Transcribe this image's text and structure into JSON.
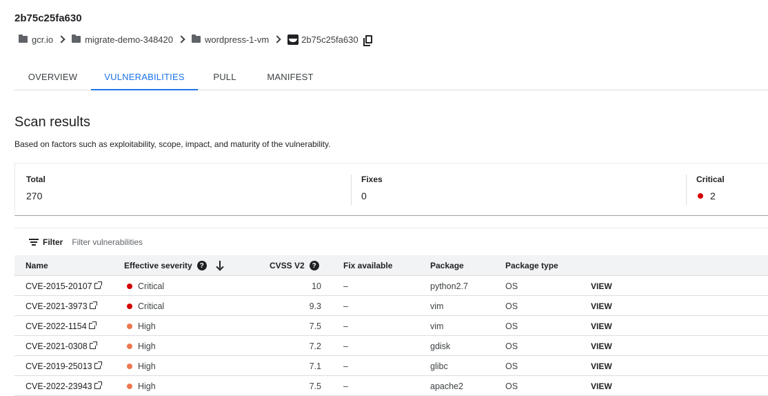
{
  "page": {
    "title": "2b75c25fa630"
  },
  "breadcrumb": [
    {
      "label": "gcr.io",
      "icon": "folder-icon"
    },
    {
      "label": "migrate-demo-348420",
      "icon": "folder-icon"
    },
    {
      "label": "wordpress-1-vm",
      "icon": "folder-icon"
    },
    {
      "label": "2b75c25fa630",
      "icon": "docker-icon"
    }
  ],
  "tabs": [
    {
      "label": "OVERVIEW",
      "active": false
    },
    {
      "label": "VULNERABILITIES",
      "active": true
    },
    {
      "label": "PULL",
      "active": false
    },
    {
      "label": "MANIFEST",
      "active": false
    }
  ],
  "scan": {
    "title": "Scan results",
    "description": "Based on factors such as exploitability, scope, impact, and maturity of the vulnerability."
  },
  "summary": {
    "total_label": "Total",
    "total_value": "270",
    "fixes_label": "Fixes",
    "fixes_value": "0",
    "critical_label": "Critical",
    "critical_value": "2"
  },
  "filter": {
    "label": "Filter",
    "placeholder": "Filter vulnerabilities"
  },
  "table": {
    "headers": {
      "name": "Name",
      "severity": "Effective severity",
      "cvss": "CVSS V2",
      "fix": "Fix available",
      "package": "Package",
      "package_type": "Package type"
    },
    "rows": [
      {
        "name": "CVE-2015-20107",
        "severity": "Critical",
        "cvss": "10",
        "fix": "–",
        "package": "python2.7",
        "package_type": "OS",
        "action": "VIEW"
      },
      {
        "name": "CVE-2021-3973",
        "severity": "Critical",
        "cvss": "9.3",
        "fix": "–",
        "package": "vim",
        "package_type": "OS",
        "action": "VIEW"
      },
      {
        "name": "CVE-2022-1154",
        "severity": "High",
        "cvss": "7.5",
        "fix": "–",
        "package": "vim",
        "package_type": "OS",
        "action": "VIEW"
      },
      {
        "name": "CVE-2021-0308",
        "severity": "High",
        "cvss": "7.2",
        "fix": "–",
        "package": "gdisk",
        "package_type": "OS",
        "action": "VIEW"
      },
      {
        "name": "CVE-2019-25013",
        "severity": "High",
        "cvss": "7.1",
        "fix": "–",
        "package": "glibc",
        "package_type": "OS",
        "action": "VIEW"
      },
      {
        "name": "CVE-2022-23943",
        "severity": "High",
        "cvss": "7.5",
        "fix": "–",
        "package": "apache2",
        "package_type": "OS",
        "action": "VIEW"
      }
    ]
  },
  "colors": {
    "accent": "#1a73e8",
    "critical": "#d50000",
    "high": "#ef7650"
  }
}
